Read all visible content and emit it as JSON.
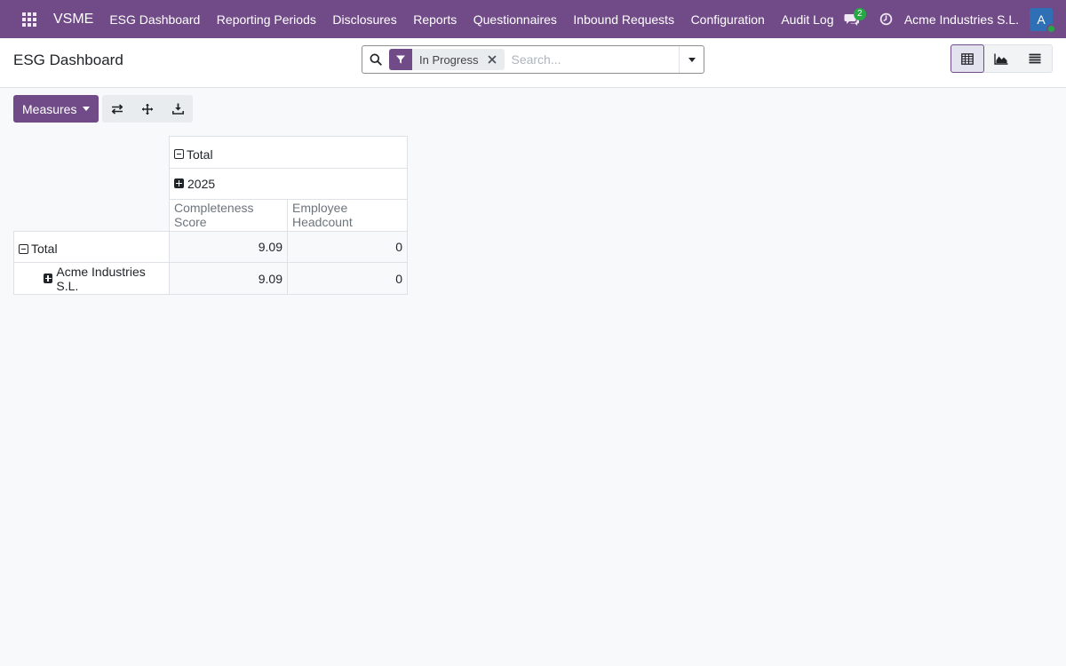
{
  "navbar": {
    "brand": "VSME",
    "menu": [
      {
        "label": "ESG Dashboard"
      },
      {
        "label": "Reporting Periods"
      },
      {
        "label": "Disclosures"
      },
      {
        "label": "Reports"
      },
      {
        "label": "Questionnaires"
      },
      {
        "label": "Inbound Requests"
      },
      {
        "label": "Configuration"
      },
      {
        "label": "Audit Log"
      }
    ],
    "messages_count": "2",
    "company": "Acme Industries S.L.",
    "avatar_letter": "A",
    "colors": {
      "navbar_bg": "#714b87",
      "badge": "#28a745",
      "avatar": "#2f6fb5"
    },
    "icons": [
      "apps-grid-icon",
      "chat-icon",
      "clock-icon"
    ]
  },
  "control_panel": {
    "title": "ESG Dashboard",
    "search": {
      "facet_label": "In Progress",
      "placeholder": "Search...",
      "icons": [
        "search-icon",
        "filter-icon",
        "close-icon",
        "caret-down-icon"
      ]
    },
    "views": [
      {
        "name": "pivot",
        "icon": "table-icon",
        "active": true
      },
      {
        "name": "graph",
        "icon": "area-chart-icon",
        "active": false
      },
      {
        "name": "list",
        "icon": "list-icon",
        "active": false
      }
    ]
  },
  "pivot_toolbar": {
    "measures_label": "Measures",
    "tools": [
      "flip-axis-icon",
      "expand-all-icon",
      "download-icon"
    ]
  },
  "pivot": {
    "col_total_label": "Total",
    "col_group_label": "2025",
    "measures": [
      "Completeness Score",
      "Employee Headcount"
    ],
    "rows": [
      {
        "label": "Total",
        "values": [
          "9.09",
          "0"
        ],
        "expanded": true
      },
      {
        "label": "Acme Industries S.L.",
        "values": [
          "9.09",
          "0"
        ],
        "expanded": false
      }
    ]
  }
}
